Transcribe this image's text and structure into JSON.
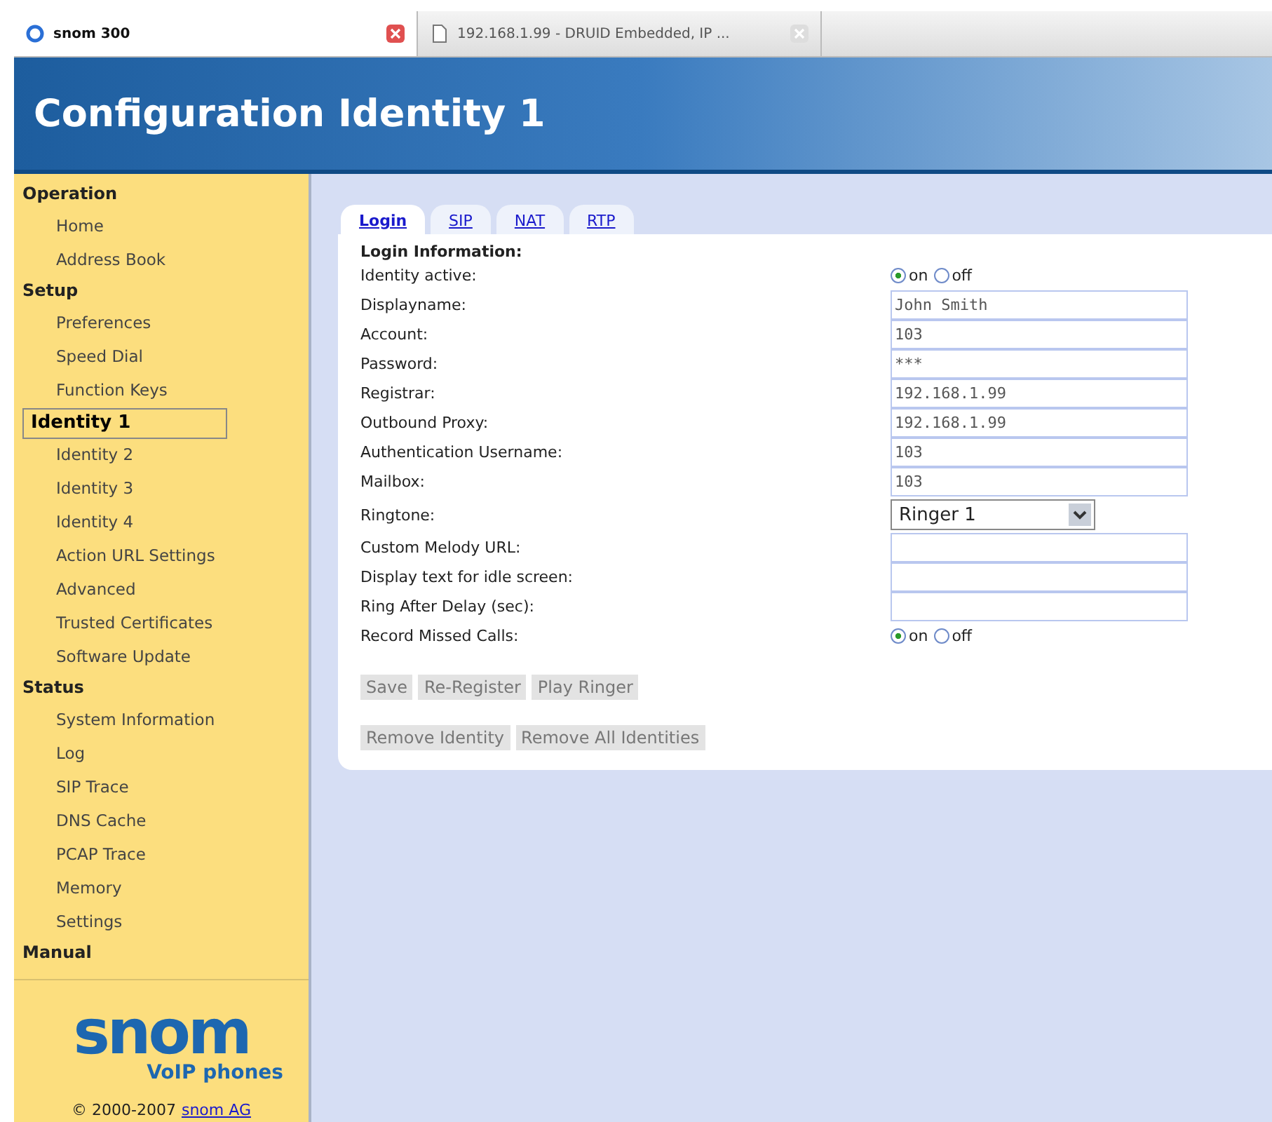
{
  "browser_tabs": [
    {
      "title": "snom 300",
      "selected": true
    },
    {
      "title": "192.168.1.99 - DRUID Embedded, IP ...",
      "selected": false
    }
  ],
  "header": {
    "title": "Configuration Identity 1"
  },
  "sidebar": {
    "groups": [
      {
        "label": "Operation",
        "children": [
          {
            "label": "Home",
            "selected": false
          },
          {
            "label": "Address Book",
            "selected": false
          }
        ]
      },
      {
        "label": "Setup",
        "children": [
          {
            "label": "Preferences",
            "selected": false
          },
          {
            "label": "Speed Dial",
            "selected": false
          },
          {
            "label": "Function Keys",
            "selected": false
          },
          {
            "label": "Identity 1",
            "selected": true
          },
          {
            "label": "Identity 2",
            "selected": false
          },
          {
            "label": "Identity 3",
            "selected": false
          },
          {
            "label": "Identity 4",
            "selected": false
          },
          {
            "label": "Action URL Settings",
            "selected": false
          },
          {
            "label": "Advanced",
            "selected": false
          },
          {
            "label": "Trusted Certificates",
            "selected": false
          },
          {
            "label": "Software Update",
            "selected": false
          }
        ]
      },
      {
        "label": "Status",
        "children": [
          {
            "label": "System Information",
            "selected": false
          },
          {
            "label": "Log",
            "selected": false
          },
          {
            "label": "SIP Trace",
            "selected": false
          },
          {
            "label": "DNS Cache",
            "selected": false
          },
          {
            "label": "PCAP Trace",
            "selected": false
          },
          {
            "label": "Memory",
            "selected": false
          },
          {
            "label": "Settings",
            "selected": false
          }
        ]
      },
      {
        "label": "Manual"
      }
    ],
    "logo": {
      "name": "snom",
      "tagline": "VoIP phones"
    },
    "copyright": "© 2000-2007",
    "copyright_link": "snom AG"
  },
  "tabs": [
    {
      "label": "Login",
      "selected": true
    },
    {
      "label": "SIP",
      "selected": false
    },
    {
      "label": "NAT",
      "selected": false
    },
    {
      "label": "RTP",
      "selected": false
    }
  ],
  "form": {
    "heading": "Login Information:",
    "rows": [
      {
        "kind": "radio",
        "label": "Identity active:",
        "on_label": "on",
        "off_label": "off",
        "on": true
      },
      {
        "kind": "text",
        "label": "Displayname:",
        "value": "John Smith"
      },
      {
        "kind": "text",
        "label": "Account:",
        "value": "103"
      },
      {
        "kind": "text",
        "label": "Password:",
        "value": "***"
      },
      {
        "kind": "text",
        "label": "Registrar:",
        "value": "192.168.1.99"
      },
      {
        "kind": "text",
        "label": "Outbound Proxy:",
        "value": "192.168.1.99"
      },
      {
        "kind": "text",
        "label": "Authentication Username:",
        "value": "103"
      },
      {
        "kind": "text",
        "label": "Mailbox:",
        "value": "103"
      },
      {
        "kind": "select",
        "label": "Ringtone:",
        "value": "Ringer 1"
      },
      {
        "kind": "text",
        "label": "Custom Melody URL:"
      },
      {
        "kind": "text",
        "label": "Display text for idle screen:"
      },
      {
        "kind": "text",
        "label": "Ring After Delay (sec):"
      },
      {
        "kind": "radio",
        "label": "Record Missed Calls:",
        "on_label": "on",
        "off_label": "off",
        "on": true
      }
    ],
    "button_rows": [
      [
        "Save",
        "Re-Register",
        "Play Ringer"
      ],
      [
        "Remove Identity",
        "Remove All Identities"
      ]
    ]
  }
}
